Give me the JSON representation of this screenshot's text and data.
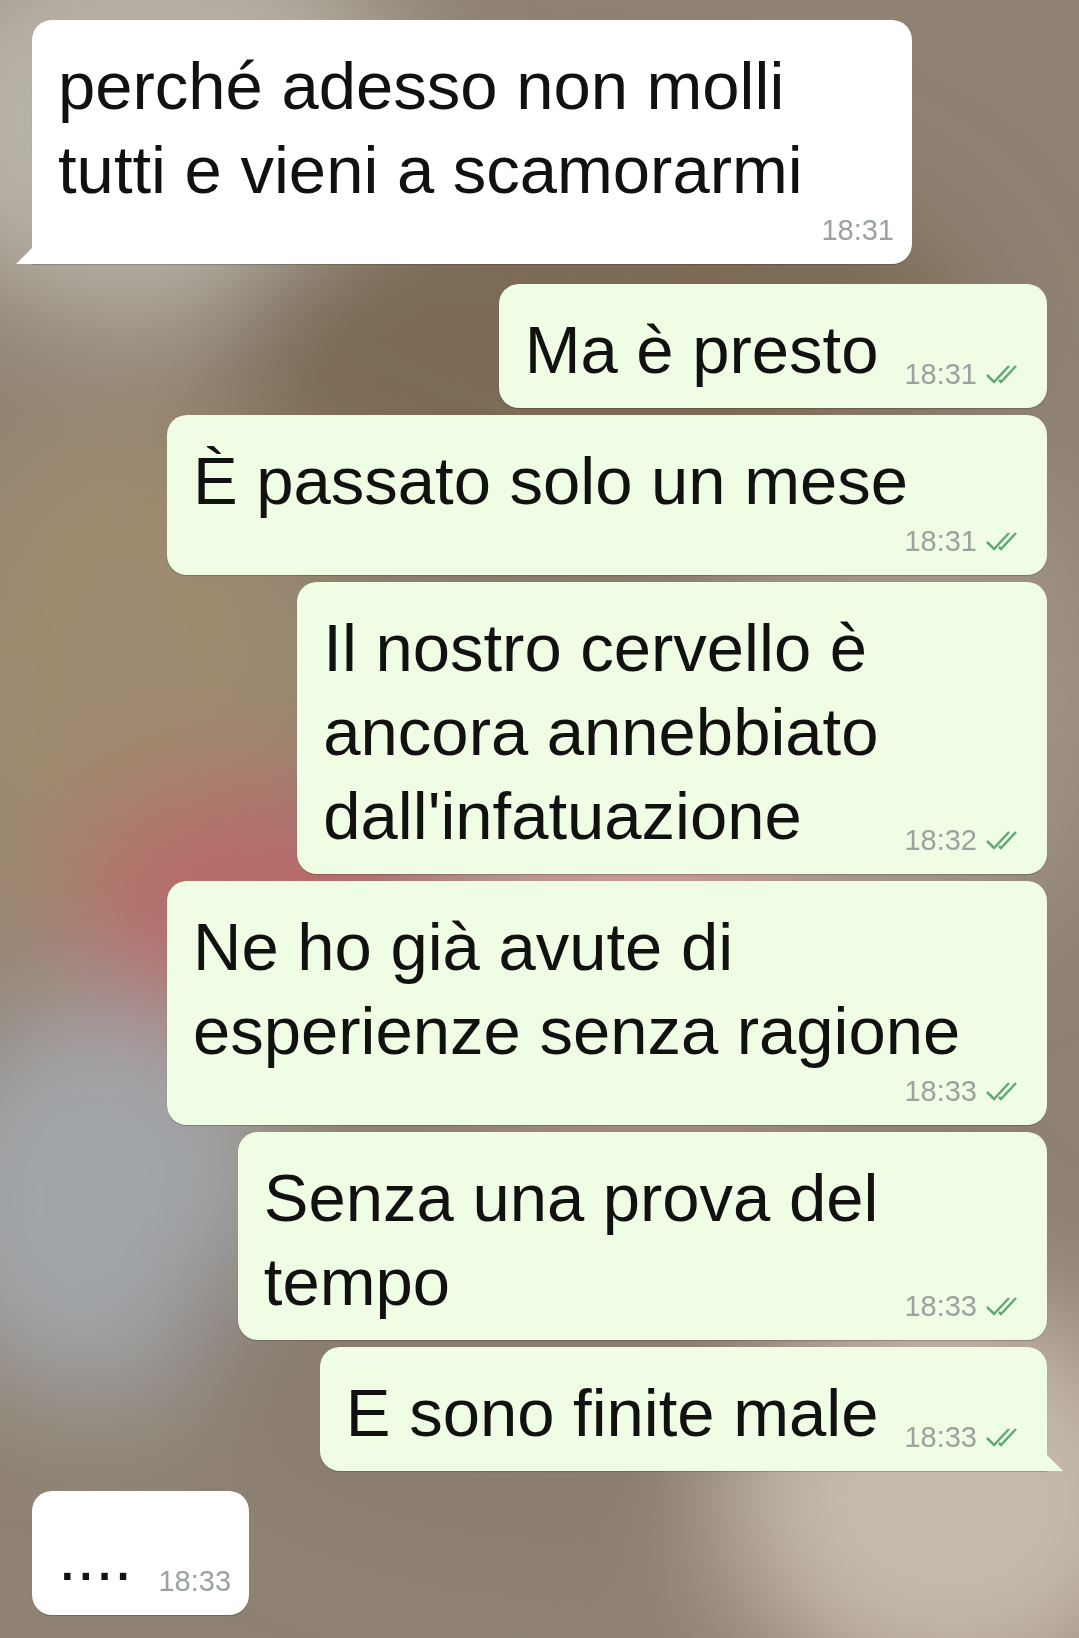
{
  "messages": [
    {
      "kind": "incoming",
      "lines": [
        "perché adesso non molli",
        "tutti e vieni a scamorarmi"
      ],
      "time": "18:31",
      "tail": true
    },
    {
      "kind": "outgoing",
      "lines": [
        "Ma è presto"
      ],
      "time": "18:31",
      "delivered": true,
      "tail": false
    },
    {
      "kind": "outgoing",
      "lines": [
        "È passato solo un mese"
      ],
      "time": "18:31",
      "delivered": true,
      "tail": false
    },
    {
      "kind": "outgoing",
      "lines": [
        "Il nostro cervello è",
        "ancora annebbiato",
        "dall'infatuazione"
      ],
      "time": "18:32",
      "delivered": true,
      "tail": false
    },
    {
      "kind": "outgoing",
      "lines": [
        "Ne ho già avute di",
        "esperienze senza ragione"
      ],
      "time": "18:33",
      "delivered": true,
      "tail": false
    },
    {
      "kind": "outgoing",
      "lines": [
        "Senza una prova del",
        "tempo"
      ],
      "time": "18:33",
      "delivered": true,
      "tail": false
    },
    {
      "kind": "outgoing",
      "lines": [
        "E sono finite male"
      ],
      "time": "18:33",
      "delivered": true,
      "tail": true
    },
    {
      "kind": "incoming",
      "lines": [
        "...."
      ],
      "time": "18:33",
      "tail": false
    }
  ]
}
